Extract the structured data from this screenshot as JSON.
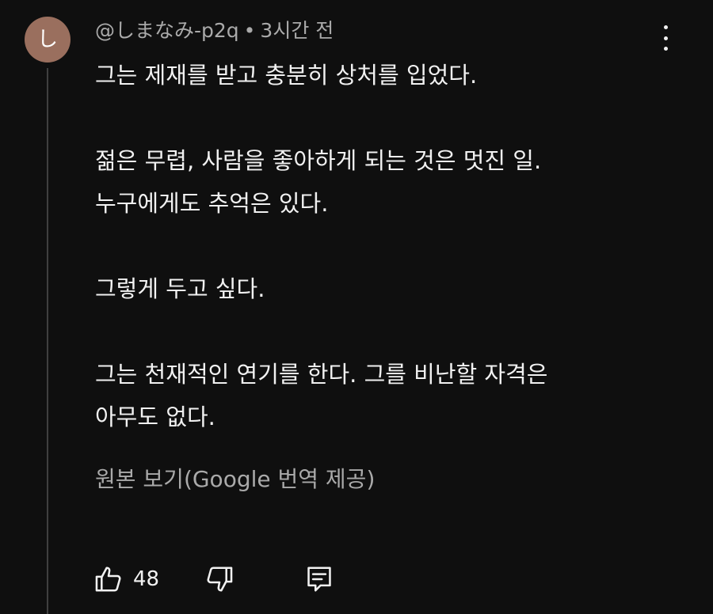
{
  "comment": {
    "avatar_letter": "し",
    "avatar_color": "#9a6f5e",
    "author": "@しまなみ-p2q",
    "separator": "•",
    "timestamp": "3시간 전",
    "lines": [
      "그는 제재를 받고 충분히 상처를 입었다.",
      "젊은 무렵, 사람을 좋아하게 되는 것은 멋진 일.",
      "누구에게도 추억은 있다.",
      "그렇게 두고 싶다.",
      "그는 천재적인 연기를 한다. 그를 비난할 자격은",
      "아무도 없다."
    ],
    "translate_link": "원본 보기(Google 번역 제공)",
    "like_count": "48",
    "icons": {
      "menu": "more-vert-icon",
      "like": "thumbs-up-icon",
      "dislike": "thumbs-down-icon",
      "reply": "reply-comment-icon"
    }
  }
}
